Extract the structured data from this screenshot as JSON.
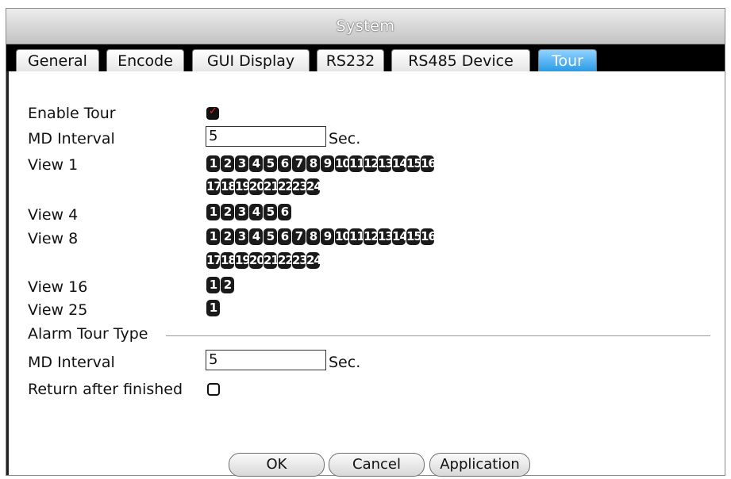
{
  "window": {
    "title": "System"
  },
  "tabs": [
    {
      "label": "General"
    },
    {
      "label": "Encode"
    },
    {
      "label": "GUI Display"
    },
    {
      "label": "RS232"
    },
    {
      "label": "RS485 Device"
    },
    {
      "label": "Tour"
    }
  ],
  "active_tab": "Tour",
  "form": {
    "enable_tour": {
      "label": "Enable Tour",
      "checked": true
    },
    "md_interval": {
      "label": "MD Interval",
      "value": "5",
      "unit": "Sec."
    },
    "views": [
      {
        "label": "View 1",
        "rows": [
          [
            "1",
            "2",
            "3",
            "4",
            "5",
            "6",
            "7",
            "8",
            "9",
            "10",
            "11",
            "12",
            "13",
            "14",
            "15",
            "16"
          ],
          [
            "17",
            "18",
            "19",
            "20",
            "21",
            "22",
            "23",
            "24"
          ]
        ]
      },
      {
        "label": "View 4",
        "rows": [
          [
            "1",
            "2",
            "3",
            "4",
            "5",
            "6"
          ]
        ]
      },
      {
        "label": "View 8",
        "rows": [
          [
            "1",
            "2",
            "3",
            "4",
            "5",
            "6",
            "7",
            "8",
            "9",
            "10",
            "11",
            "12",
            "13",
            "14",
            "15",
            "16"
          ],
          [
            "17",
            "18",
            "19",
            "20",
            "21",
            "22",
            "23",
            "24"
          ]
        ]
      },
      {
        "label": "View 16",
        "rows": [
          [
            "1",
            "2"
          ]
        ]
      },
      {
        "label": "View 25",
        "rows": [
          [
            "1"
          ]
        ]
      }
    ],
    "alarm_tour_type": {
      "label": "Alarm Tour Type"
    },
    "alarm_md_interval": {
      "label": "MD Interval",
      "value": "5",
      "unit": "Sec."
    },
    "return_after_finished": {
      "label": "Return after finished",
      "checked": false
    }
  },
  "buttons": {
    "ok": "OK",
    "cancel": "Cancel",
    "application": "Application"
  }
}
